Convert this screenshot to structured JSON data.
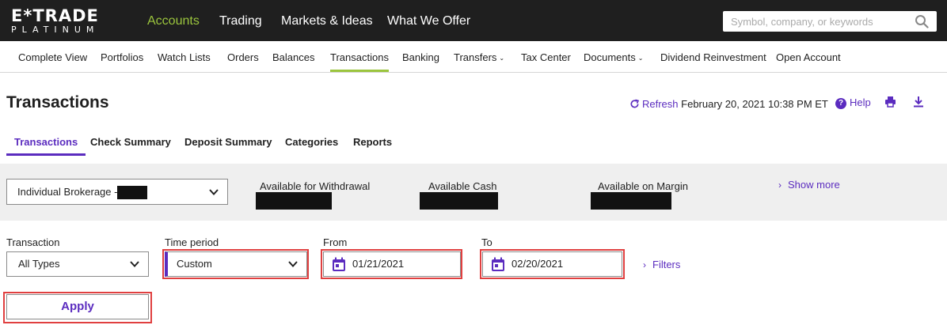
{
  "brand": {
    "name": "E*TRADE",
    "tier": "PLATINUM"
  },
  "top_nav": [
    {
      "label": "Accounts",
      "active": true
    },
    {
      "label": "Trading"
    },
    {
      "label": "Markets & Ideas"
    },
    {
      "label": "What We Offer"
    }
  ],
  "search": {
    "placeholder": "Symbol, company, or keywords",
    "icon": "search-icon"
  },
  "sub_nav": [
    {
      "label": "Complete View"
    },
    {
      "label": "Portfolios"
    },
    {
      "label": "Watch Lists"
    },
    {
      "label": "Orders"
    },
    {
      "label": "Balances"
    },
    {
      "label": "Transactions",
      "active": true
    },
    {
      "label": "Banking"
    },
    {
      "label": "Transfers",
      "dropdown": true
    },
    {
      "label": "Tax Center"
    },
    {
      "label": "Documents",
      "dropdown": true
    },
    {
      "label": "Dividend Reinvestment"
    },
    {
      "label": "Open Account"
    }
  ],
  "header": {
    "title": "Transactions",
    "refresh_label": "Refresh",
    "timestamp": "February 20, 2021 10:38 PM ET",
    "help_label": "Help",
    "icons": [
      "refresh-icon",
      "help-icon",
      "print-icon",
      "download-icon"
    ]
  },
  "tabs": [
    {
      "label": "Transactions",
      "active": true
    },
    {
      "label": "Check Summary"
    },
    {
      "label": "Deposit Summary"
    },
    {
      "label": "Categories"
    },
    {
      "label": "Reports"
    }
  ],
  "account": {
    "selected": "Individual Brokerage -",
    "summary": [
      {
        "label": "Available for Withdrawal"
      },
      {
        "label": "Available Cash"
      },
      {
        "label": "Available on Margin"
      }
    ],
    "show_more": "Show more"
  },
  "filters": {
    "transaction": {
      "label": "Transaction",
      "value": "All Types"
    },
    "time_period": {
      "label": "Time period",
      "value": "Custom"
    },
    "from": {
      "label": "From",
      "value": "01/21/2021"
    },
    "to": {
      "label": "To",
      "value": "02/20/2021"
    },
    "filters_link": "Filters",
    "apply_label": "Apply"
  },
  "colors": {
    "topbar": "#1f1f1f",
    "accent_green": "#9bc53d",
    "accent_purple": "#5b2cbf",
    "highlight_red": "#e04040",
    "strip_bg": "#efefef"
  }
}
